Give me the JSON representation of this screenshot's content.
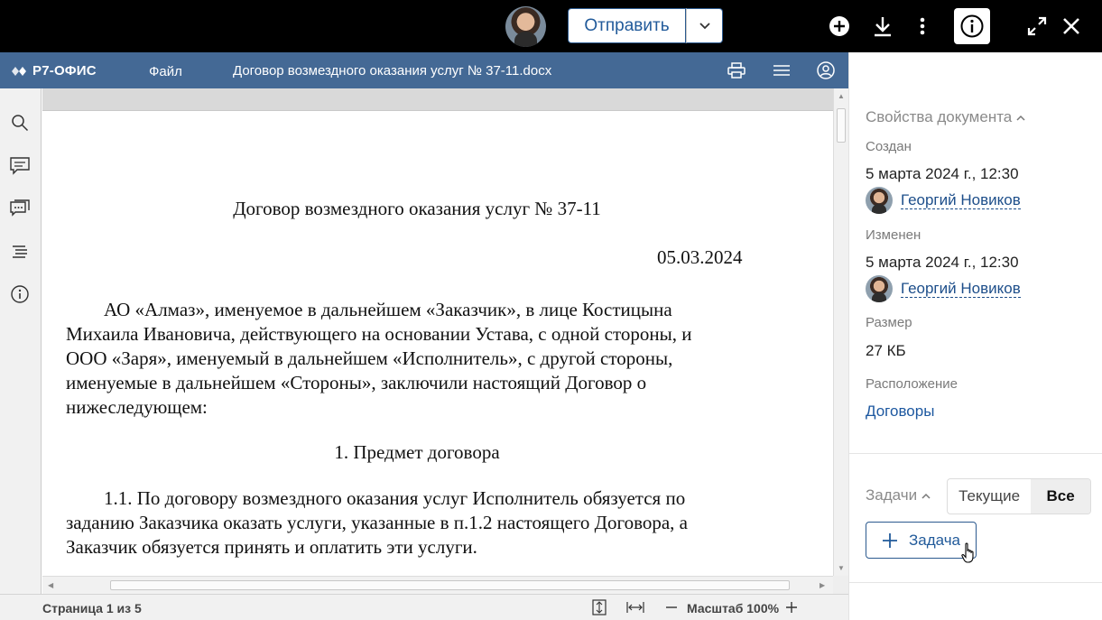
{
  "topbar": {
    "send_label": "Отправить",
    "icons": [
      "avatar",
      "chevron-down-icon",
      "plus-circle-icon",
      "download-icon",
      "more-vertical-icon",
      "info-icon",
      "expand-icon",
      "close-icon"
    ]
  },
  "editor": {
    "logo_text": "Р7-ОФИС",
    "file_menu": "Файл",
    "doc_title": "Договор возмездного оказания услуг № 37-11.docx",
    "header_icons": [
      "print-icon",
      "menu-icon",
      "user-icon"
    ],
    "rail_icons": [
      "search-icon",
      "comment-icon",
      "chat-icon",
      "navigation-icon",
      "info-icon"
    ]
  },
  "document": {
    "title": "Договор возмездного оказания услуг № 37-11",
    "date": "05.03.2024",
    "para1_lines": [
      "АО «Алмаз», именуемое в дальнейшем «Заказчик», в лице Костицына",
      "Михаила Ивановича, действующего на основании Устава, с одной стороны, и",
      "ООО «Заря», именуемый в дальнейшем «Исполнитель», с другой стороны,",
      "именуемые в дальнейшем «Стороны», заключили настоящий Договор о",
      "нижеследующем:"
    ],
    "section1": "1. Предмет договора",
    "para2_lines": [
      "1.1. По договору возмездного оказания услуг Исполнитель обязуется по",
      "заданию Заказчика оказать услуги, указанные в п.1.2 настоящего Договора, а",
      "Заказчик обязуется принять и оплатить эти услуги."
    ]
  },
  "statusbar": {
    "page_info": "Страница 1 из 5",
    "zoom_label": "Масштаб 100%"
  },
  "properties": {
    "section_title": "Свойства документа",
    "created_label": "Создан",
    "created_value": "5 марта 2024 г., 12:30",
    "created_by": "Георгий Новиков",
    "modified_label": "Изменен",
    "modified_value": "5 марта 2024 г., 12:30",
    "modified_by": "Георгий Новиков",
    "size_label": "Размер",
    "size_value": "27 КБ",
    "location_label": "Расположение",
    "location_value": "Договоры"
  },
  "tasks": {
    "section_title": "Задачи",
    "tab_current": "Текущие",
    "tab_all": "Все",
    "active_tab": "Все",
    "add_task_label": "Задача"
  },
  "colors": {
    "header_blue": "#446995",
    "accent_blue": "#215a9a",
    "topbar": "#000000"
  }
}
